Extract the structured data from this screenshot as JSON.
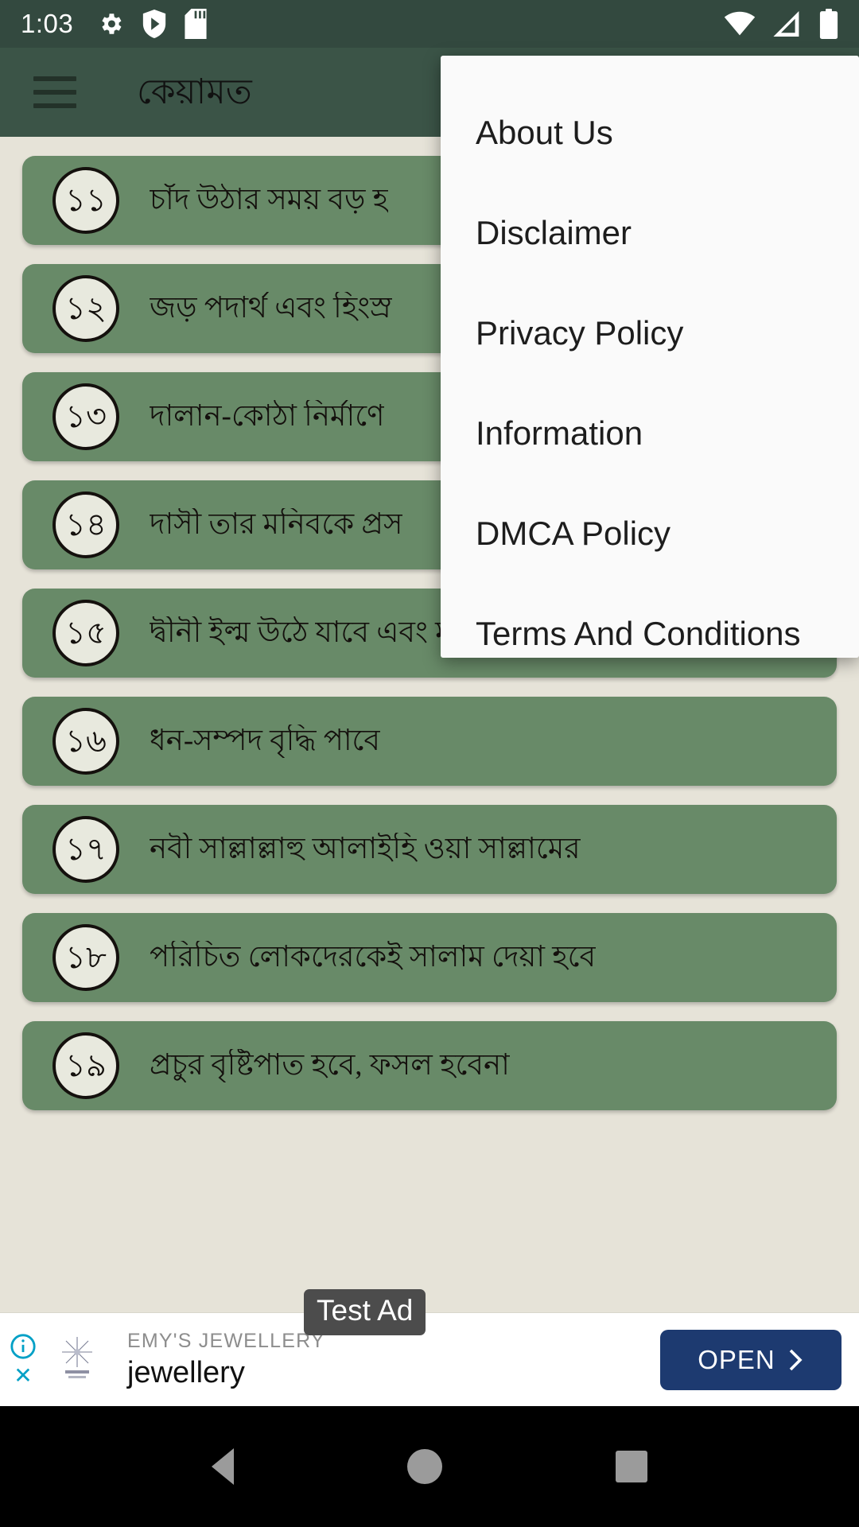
{
  "statusbar": {
    "time": "1:03",
    "left_icons": [
      "gear-icon",
      "shield-play-icon",
      "sd-card-icon"
    ],
    "right_icons": [
      "wifi-icon",
      "cell-signal-icon",
      "battery-icon"
    ],
    "background_color": "#33493f"
  },
  "appbar": {
    "menu_icon": "hamburger-icon",
    "title": "কেয়ামত",
    "background_color": "#3b5447"
  },
  "overflow_menu": {
    "visible": true,
    "items": [
      {
        "label": "About Us"
      },
      {
        "label": "Disclaimer"
      },
      {
        "label": "Privacy Policy"
      },
      {
        "label": "Information"
      },
      {
        "label": "DMCA Policy"
      },
      {
        "label": "Terms And Conditions"
      }
    ]
  },
  "list": {
    "card_color": "#688a68",
    "background_color": "#e6e3d8",
    "items": [
      {
        "number": "১১",
        "text": "চাঁদ উঠার সময় বড় হ"
      },
      {
        "number": "১২",
        "text": "জড় পদার্থ এবং হিংস্র"
      },
      {
        "number": "১৩",
        "text": "দালান-কোঠা নির্মাণে "
      },
      {
        "number": "১৪",
        "text": "দাসী তার মনিবকে প্রস"
      },
      {
        "number": "১৫",
        "text": "দ্বীনী ইল্ম উঠে যাবে এবং মূর্খতা বিস্তার"
      },
      {
        "number": "১৬",
        "text": "ধন-সম্পদ বৃদ্ধি পাবে"
      },
      {
        "number": "১৭",
        "text": "নবী সাল্লাল্লাহু আলাইহি ওয়া সাল্লামের"
      },
      {
        "number": "১৮",
        "text": "পরিচিত লোকদেরকেই সালাম দেয়া হবে"
      },
      {
        "number": "১৯",
        "text": "প্রচুর বৃষ্টিপাত হবে, ফসল হবেনা"
      }
    ]
  },
  "ad": {
    "badge": "Test Ad",
    "brand": "EMY'S JEWELLERY",
    "headline": "jewellery",
    "cta_label": "OPEN",
    "cta_color": "#1d3a70",
    "info_icon": "info-icon",
    "close_icon": "close-icon"
  },
  "navbar": {
    "back": "back-triangle-icon",
    "home": "home-circle-icon",
    "recents": "recents-square-icon"
  }
}
